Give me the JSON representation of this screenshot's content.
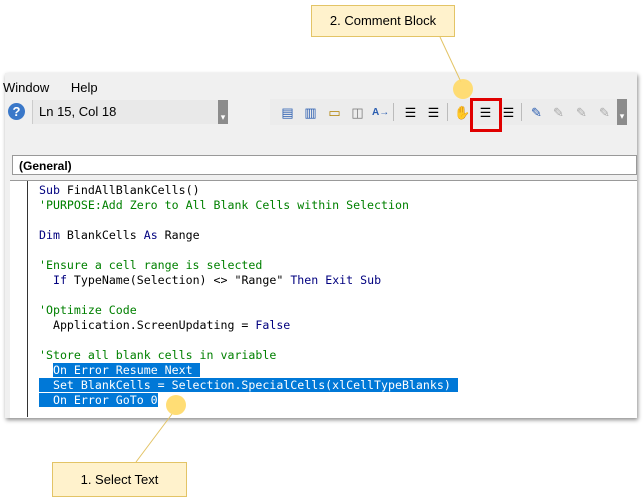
{
  "menu": {
    "items": [
      {
        "label": "Window",
        "accel": "W"
      },
      {
        "label": "Help",
        "accel": "H"
      }
    ]
  },
  "status": {
    "position": "Ln 15, Col 18"
  },
  "toolbar": {
    "icons": [
      "properties-window-icon",
      "list-properties-icon",
      "list-constants-icon",
      "quick-info-icon",
      "parameter-info-icon",
      "indent-icon",
      "outdent-icon",
      "toggle-breakpoint-icon",
      "comment-block-icon",
      "uncomment-block-icon",
      "toggle-bookmark-icon",
      "next-bookmark-icon",
      "previous-bookmark-icon",
      "clear-bookmarks-icon"
    ]
  },
  "object_combo": {
    "value": "(General)"
  },
  "code": {
    "lines": [
      [
        {
          "t": "Sub",
          "c": "kw"
        },
        {
          "t": " FindAllBlankCells()",
          "c": ""
        }
      ],
      [
        {
          "t": "'PURPOSE:Add Zero to All Blank Cells within Selection",
          "c": "cm"
        }
      ],
      [],
      [
        {
          "t": "Dim",
          "c": "kw"
        },
        {
          "t": " BlankCells ",
          "c": ""
        },
        {
          "t": "As",
          "c": "kw"
        },
        {
          "t": " Range",
          "c": ""
        }
      ],
      [],
      [
        {
          "t": "'Ensure a cell range is selected",
          "c": "cm"
        }
      ],
      [
        {
          "t": "  ",
          "c": ""
        },
        {
          "t": "If",
          "c": "kw"
        },
        {
          "t": " TypeName(Selection) <> \"Range\" ",
          "c": ""
        },
        {
          "t": "Then Exit Sub",
          "c": "kw"
        }
      ],
      [],
      [
        {
          "t": "'Optimize Code",
          "c": "cm"
        }
      ],
      [
        {
          "t": "  Application.ScreenUpdating = ",
          "c": ""
        },
        {
          "t": "False",
          "c": "kw"
        }
      ],
      [],
      [
        {
          "t": "'Store all blank cells in variable",
          "c": "cm"
        }
      ],
      [
        {
          "t": "  ",
          "c": ""
        },
        {
          "t": "On Error Resume Next ",
          "c": "sel"
        }
      ],
      [
        {
          "t": "  Set BlankCells = Selection.SpecialCells(xlCellTypeBlanks) ",
          "c": "sel"
        }
      ],
      [
        {
          "t": "  On Error GoTo 0",
          "c": "sel"
        }
      ]
    ]
  },
  "callouts": {
    "comment_block": "2. Comment Block",
    "select_text": "1. Select Text"
  },
  "colors": {
    "selection": "#0078d7",
    "comment": "#008000",
    "keyword": "#00007f",
    "highlight_box": "#e00000",
    "callout_fill": "#fff2cc"
  }
}
